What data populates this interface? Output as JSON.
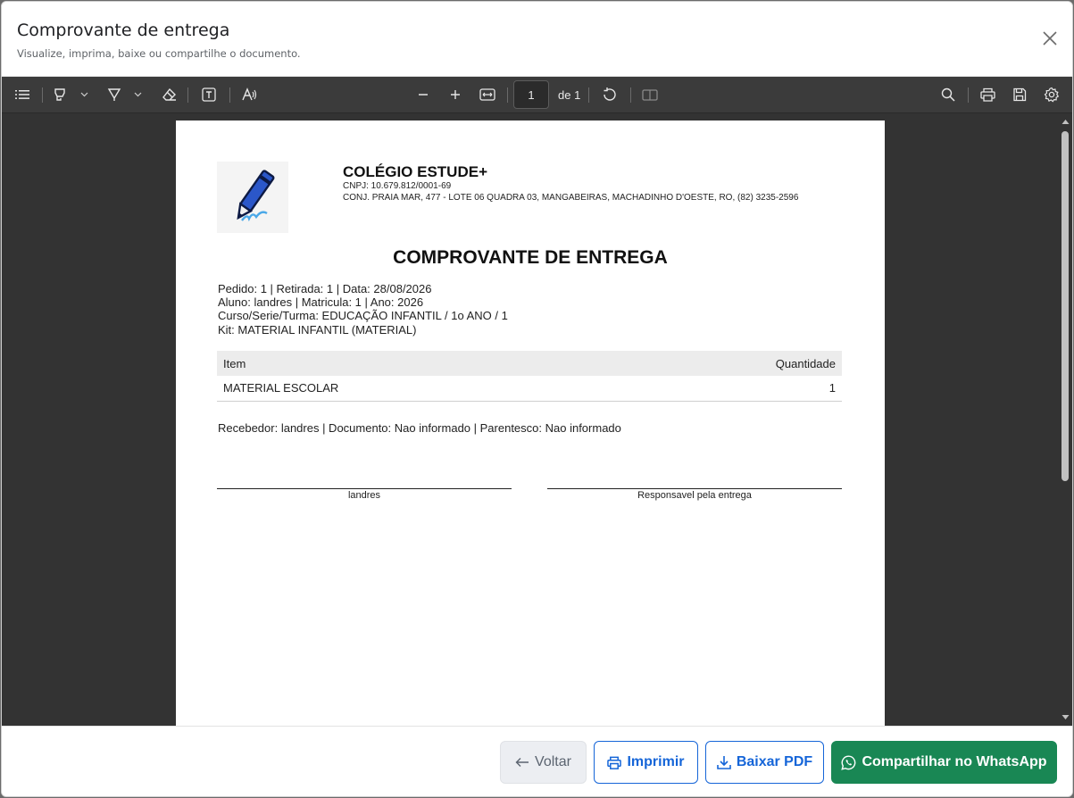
{
  "modal": {
    "title": "Comprovante de entrega",
    "subtitle": "Visualize, imprima, baixe ou compartilhe o documento."
  },
  "toolbar": {
    "left_icons": [
      "list-icon",
      "highlight-icon",
      "chevron-down-icon",
      "draw-icon",
      "chevron-down-icon",
      "eraser-icon",
      "text-icon",
      "read-aloud-icon"
    ],
    "center_icons": [
      "zoom-out-icon",
      "zoom-in-icon",
      "fit-width-icon",
      "rotate-icon",
      "page-view-icon"
    ],
    "right_icons": [
      "search-icon",
      "print-icon",
      "save-icon",
      "settings-icon"
    ],
    "page_current": "1",
    "page_total": "de 1"
  },
  "document": {
    "school_name": "COLÉGIO ESTUDE+",
    "cnpj": "CNPJ: 10.679.812/0001-69",
    "address": "CONJ. PRAIA MAR, 477 - LOTE 06 QUADRA 03, MANGABEIRAS, MACHADINHO D'OESTE, RO, (82) 3235-2596",
    "title": "COMPROVANTE DE ENTREGA",
    "info_lines": [
      "Pedido: 1  |  Retirada: 1  |  Data: 28/08/2026",
      "Aluno: landres  |  Matricula: 1  |  Ano: 2026",
      "Curso/Serie/Turma: EDUCAÇÃO INFANTIL / 1o ANO / 1",
      "Kit: MATERIAL INFANTIL (MATERIAL)"
    ],
    "table": {
      "headers": [
        "Item",
        "Quantidade"
      ],
      "rows": [
        [
          "MATERIAL ESCOLAR",
          "1"
        ]
      ]
    },
    "receiver_line": "Recebedor: landres  |  Documento: Nao informado  |  Parentesco: Nao informado",
    "signature_left": "landres",
    "signature_right": "Responsavel pela entrega"
  },
  "footer": {
    "back_label": "Voltar",
    "print_label": "Imprimir",
    "pdf_label": "Baixar PDF",
    "whatsapp_label": "Compartilhar no WhatsApp"
  },
  "colors": {
    "toolbar_bg": "#3b3b3b",
    "viewer_bg": "#333333",
    "primary": "#1565d8",
    "whatsapp": "#198754"
  }
}
